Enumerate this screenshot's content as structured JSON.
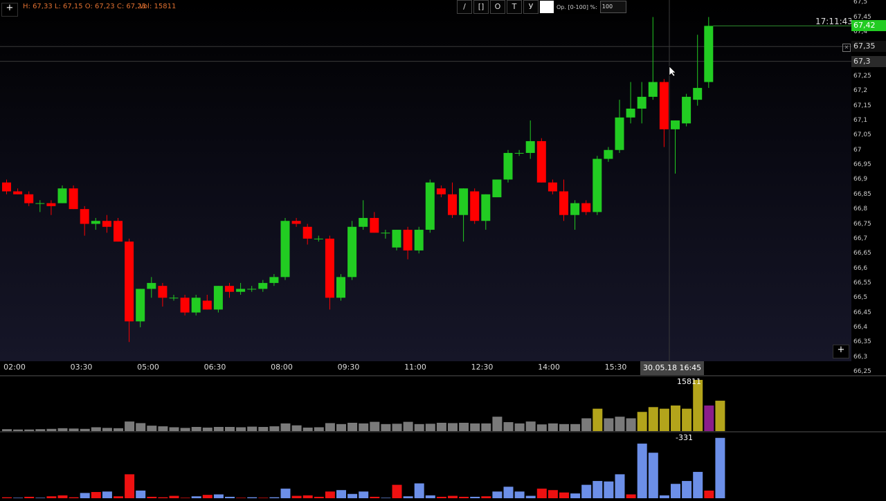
{
  "header": {
    "ohlc_text": "H: 67,33 L: 67,15 O: 67,23 C: 67,23",
    "volume_text": "Vol: 15811"
  },
  "toolbar": {
    "tools": [
      "/",
      "[]",
      "O",
      "T",
      "У"
    ],
    "opacity_label": "Op. [0-100] %:",
    "opacity_value": "100"
  },
  "clock": "17:11:43",
  "crosshair_time": "30.05.18 16:45",
  "current_price": "67,42",
  "alert_price": "67,35",
  "crosshair_price": "67,3",
  "price_axis_labels": [
    "67,5",
    "67,45",
    "67,4",
    "67,35",
    "67,3",
    "67,25",
    "67,2",
    "67,15",
    "67,1",
    "67,05",
    "67",
    "66,95",
    "66,9",
    "66,85",
    "66,8",
    "66,75",
    "66,7",
    "66,65",
    "66,6",
    "66,55",
    "66,5",
    "66,45",
    "66,4",
    "66,35",
    "66,3",
    "66,25"
  ],
  "time_axis_labels": [
    "02:00",
    "03:30",
    "05:00",
    "06:30",
    "08:00",
    "09:30",
    "11:00",
    "12:30",
    "14:00",
    "15:30"
  ],
  "volume_readout": "15811",
  "delta_readout": "-331",
  "colors": {
    "up": "#22cc22",
    "down": "#ff0000",
    "volume_normal": "#7a7a7a",
    "volume_high": "#b3a41b",
    "volume_current": "#8b1d8b",
    "delta_positive": "#6c8fe8",
    "delta_negative": "#ee1111"
  },
  "chart_data": {
    "type": "candlestick",
    "interval_minutes": 15,
    "candles": [
      {
        "time": "01:15",
        "o": 66.89,
        "h": 66.9,
        "l": 66.85,
        "c": 66.86
      },
      {
        "time": "01:30",
        "o": 66.86,
        "h": 66.87,
        "l": 66.85,
        "c": 66.85
      },
      {
        "time": "01:45",
        "o": 66.85,
        "h": 66.86,
        "l": 66.81,
        "c": 66.82
      },
      {
        "time": "02:00",
        "o": 66.82,
        "h": 66.83,
        "l": 66.79,
        "c": 66.82
      },
      {
        "time": "02:15",
        "o": 66.82,
        "h": 66.83,
        "l": 66.78,
        "c": 66.81
      },
      {
        "time": "02:30",
        "o": 66.82,
        "h": 66.88,
        "l": 66.82,
        "c": 66.87
      },
      {
        "time": "02:45",
        "o": 66.87,
        "h": 66.88,
        "l": 66.8,
        "c": 66.8
      },
      {
        "time": "03:00",
        "o": 66.8,
        "h": 66.81,
        "l": 66.71,
        "c": 66.75
      },
      {
        "time": "03:15",
        "o": 66.75,
        "h": 66.77,
        "l": 66.73,
        "c": 66.76
      },
      {
        "time": "03:30",
        "o": 66.76,
        "h": 66.78,
        "l": 66.72,
        "c": 66.74
      },
      {
        "time": "03:45",
        "o": 66.76,
        "h": 66.77,
        "l": 66.69,
        "c": 66.69
      },
      {
        "time": "04:00",
        "o": 66.69,
        "h": 66.7,
        "l": 66.35,
        "c": 66.42
      },
      {
        "time": "04:15",
        "o": 66.42,
        "h": 66.53,
        "l": 66.4,
        "c": 66.53
      },
      {
        "time": "04:30",
        "o": 66.53,
        "h": 66.57,
        "l": 66.5,
        "c": 66.55
      },
      {
        "time": "04:45",
        "o": 66.54,
        "h": 66.55,
        "l": 66.47,
        "c": 66.5
      },
      {
        "time": "05:00",
        "o": 66.5,
        "h": 66.51,
        "l": 66.49,
        "c": 66.5
      },
      {
        "time": "05:15",
        "o": 66.5,
        "h": 66.51,
        "l": 66.44,
        "c": 66.45
      },
      {
        "time": "05:30",
        "o": 66.45,
        "h": 66.51,
        "l": 66.44,
        "c": 66.5
      },
      {
        "time": "05:45",
        "o": 66.49,
        "h": 66.51,
        "l": 66.46,
        "c": 66.46
      },
      {
        "time": "06:00",
        "o": 66.46,
        "h": 66.54,
        "l": 66.45,
        "c": 66.54
      },
      {
        "time": "06:15",
        "o": 66.54,
        "h": 66.55,
        "l": 66.5,
        "c": 66.52
      },
      {
        "time": "06:30",
        "o": 66.52,
        "h": 66.55,
        "l": 66.51,
        "c": 66.53
      },
      {
        "time": "06:45",
        "o": 66.53,
        "h": 66.54,
        "l": 66.52,
        "c": 66.53
      },
      {
        "time": "07:00",
        "o": 66.53,
        "h": 66.56,
        "l": 66.52,
        "c": 66.55
      },
      {
        "time": "07:15",
        "o": 66.55,
        "h": 66.58,
        "l": 66.54,
        "c": 66.57
      },
      {
        "time": "07:30",
        "o": 66.57,
        "h": 66.77,
        "l": 66.56,
        "c": 66.76
      },
      {
        "time": "07:45",
        "o": 66.76,
        "h": 66.77,
        "l": 66.74,
        "c": 66.75
      },
      {
        "time": "08:00",
        "o": 66.74,
        "h": 66.75,
        "l": 66.68,
        "c": 66.7
      },
      {
        "time": "08:15",
        "o": 66.7,
        "h": 66.71,
        "l": 66.69,
        "c": 66.7
      },
      {
        "time": "08:30",
        "o": 66.7,
        "h": 66.71,
        "l": 66.46,
        "c": 66.5
      },
      {
        "time": "08:45",
        "o": 66.5,
        "h": 66.58,
        "l": 66.49,
        "c": 66.57
      },
      {
        "time": "09:00",
        "o": 66.57,
        "h": 66.76,
        "l": 66.56,
        "c": 66.74
      },
      {
        "time": "09:15",
        "o": 66.74,
        "h": 66.83,
        "l": 66.73,
        "c": 66.77
      },
      {
        "time": "09:30",
        "o": 66.77,
        "h": 66.79,
        "l": 66.72,
        "c": 66.72
      },
      {
        "time": "09:45",
        "o": 66.72,
        "h": 66.73,
        "l": 66.7,
        "c": 66.72
      },
      {
        "time": "10:00",
        "o": 66.67,
        "h": 66.73,
        "l": 66.66,
        "c": 66.73
      },
      {
        "time": "10:15",
        "o": 66.73,
        "h": 66.74,
        "l": 66.63,
        "c": 66.66
      },
      {
        "time": "10:30",
        "o": 66.66,
        "h": 66.74,
        "l": 66.65,
        "c": 66.73
      },
      {
        "time": "10:45",
        "o": 66.73,
        "h": 66.9,
        "l": 66.72,
        "c": 66.89
      },
      {
        "time": "11:00",
        "o": 66.87,
        "h": 66.88,
        "l": 66.84,
        "c": 66.85
      },
      {
        "time": "11:15",
        "o": 66.85,
        "h": 66.89,
        "l": 66.77,
        "c": 66.78
      },
      {
        "time": "11:30",
        "o": 66.78,
        "h": 66.87,
        "l": 66.69,
        "c": 66.87
      },
      {
        "time": "11:45",
        "o": 66.86,
        "h": 66.87,
        "l": 66.75,
        "c": 66.76
      },
      {
        "time": "12:00",
        "o": 66.76,
        "h": 66.85,
        "l": 66.73,
        "c": 66.85
      },
      {
        "time": "12:15",
        "o": 66.84,
        "h": 66.9,
        "l": 66.84,
        "c": 66.9
      },
      {
        "time": "12:30",
        "o": 66.9,
        "h": 67.0,
        "l": 66.89,
        "c": 66.99
      },
      {
        "time": "12:45",
        "o": 66.99,
        "h": 67.0,
        "l": 66.98,
        "c": 66.99
      },
      {
        "time": "13:00",
        "o": 66.99,
        "h": 67.1,
        "l": 66.97,
        "c": 67.03
      },
      {
        "time": "13:15",
        "o": 67.03,
        "h": 67.04,
        "l": 66.89,
        "c": 66.89
      },
      {
        "time": "13:30",
        "o": 66.89,
        "h": 66.9,
        "l": 66.85,
        "c": 66.86
      },
      {
        "time": "13:45",
        "o": 66.86,
        "h": 66.9,
        "l": 66.76,
        "c": 66.78
      },
      {
        "time": "14:00",
        "o": 66.78,
        "h": 66.83,
        "l": 66.73,
        "c": 66.82
      },
      {
        "time": "14:15",
        "o": 66.82,
        "h": 66.83,
        "l": 66.78,
        "c": 66.79
      },
      {
        "time": "14:30",
        "o": 66.79,
        "h": 66.98,
        "l": 66.78,
        "c": 66.97
      },
      {
        "time": "14:45",
        "o": 66.97,
        "h": 67.01,
        "l": 66.96,
        "c": 67.0
      },
      {
        "time": "15:00",
        "o": 67.0,
        "h": 67.17,
        "l": 66.99,
        "c": 67.11
      },
      {
        "time": "15:15",
        "o": 67.11,
        "h": 67.23,
        "l": 67.09,
        "c": 67.14
      },
      {
        "time": "15:30",
        "o": 67.14,
        "h": 67.23,
        "l": 67.09,
        "c": 67.18
      },
      {
        "time": "15:45",
        "o": 67.18,
        "h": 67.45,
        "l": 67.17,
        "c": 67.23
      },
      {
        "time": "16:00",
        "o": 67.23,
        "h": 67.24,
        "l": 67.01,
        "c": 67.07
      },
      {
        "time": "16:15",
        "o": 67.07,
        "h": 67.1,
        "l": 66.92,
        "c": 67.1
      },
      {
        "time": "16:30",
        "o": 67.09,
        "h": 67.19,
        "l": 67.08,
        "c": 67.18
      },
      {
        "time": "16:45",
        "o": 67.17,
        "h": 67.39,
        "l": 67.15,
        "c": 67.21
      },
      {
        "time": "17:00",
        "o": 67.23,
        "h": 67.45,
        "l": 67.21,
        "c": 67.42
      }
    ],
    "volume": [
      6,
      5,
      5,
      6,
      7,
      9,
      8,
      7,
      12,
      10,
      9,
      30,
      25,
      17,
      15,
      12,
      10,
      13,
      11,
      13,
      13,
      12,
      14,
      13,
      15,
      24,
      18,
      11,
      12,
      25,
      22,
      26,
      24,
      29,
      22,
      23,
      29,
      22,
      23,
      26,
      25,
      26,
      24,
      24,
      45,
      28,
      24,
      30,
      21,
      24,
      22,
      22,
      40,
      70,
      40,
      45,
      40,
      60,
      75,
      70,
      80,
      70,
      160,
      80,
      95
    ],
    "volume_ylim": [
      0,
      160
    ],
    "delta": [
      2,
      1,
      3,
      1,
      4,
      6,
      2,
      11,
      13,
      14,
      4,
      50,
      16,
      3,
      2,
      5,
      1,
      4,
      7,
      8,
      3,
      1,
      2,
      1,
      2,
      20,
      5,
      6,
      3,
      14,
      17,
      9,
      14,
      3,
      1,
      28,
      4,
      31,
      6,
      3,
      5,
      3,
      3,
      4,
      14,
      24,
      14,
      5,
      20,
      17,
      12,
      10,
      28,
      36,
      35,
      50,
      8,
      114,
      95,
      6,
      30,
      36,
      55,
      16,
      126
    ],
    "delta_sign": [
      "-",
      "+",
      "-",
      "+",
      "-",
      "-",
      "-",
      "+",
      "-",
      "+",
      "-",
      "-",
      "+",
      "-",
      "-",
      "-",
      "-",
      "+",
      "-",
      "+",
      "+",
      "-",
      "+",
      "-",
      "+",
      "+",
      "-",
      "-",
      "-",
      "-",
      "+",
      "+",
      "+",
      "-",
      "+",
      "-",
      "+",
      "+",
      "+",
      "-",
      "-",
      "-",
      "+",
      "-",
      "+",
      "+",
      "+",
      "+",
      "-",
      "-",
      "-",
      "+",
      "+",
      "+",
      "+",
      "+",
      "-",
      "+",
      "+",
      "+",
      "+",
      "+",
      "+",
      "-",
      "+"
    ],
    "delta_ylim": [
      0,
      130
    ]
  }
}
